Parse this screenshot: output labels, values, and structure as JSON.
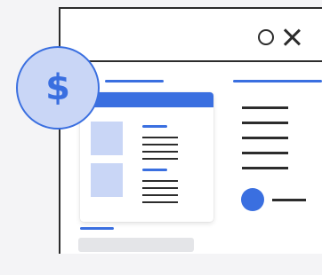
{
  "illustration": {
    "window_controls": {
      "minimize_icon": "circle-icon",
      "close_icon": "close-icon"
    },
    "badge": {
      "symbol": "$",
      "icon": "dollar-sign-icon"
    },
    "colors": {
      "accent": "#3a6fe0",
      "accent_light": "#c9d6f6",
      "outline": "#2c2c2c",
      "background": "#f4f4f6",
      "placeholder_gray": "#e4e5e8"
    }
  }
}
